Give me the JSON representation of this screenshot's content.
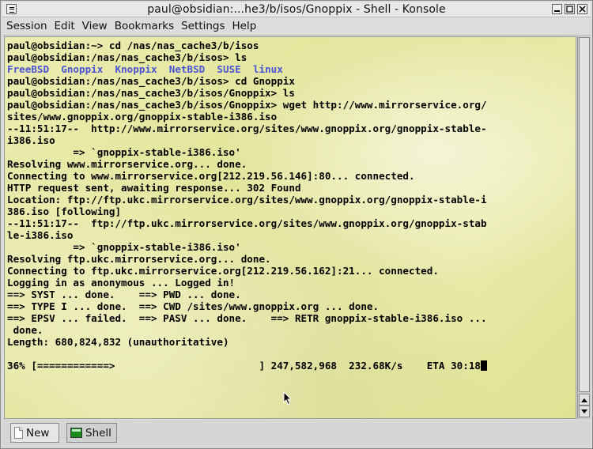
{
  "window": {
    "title": "paul@obsidian:...he3/b/isos/Gnoppix - Shell - Konsole"
  },
  "menubar": {
    "items": [
      "Session",
      "Edit",
      "View",
      "Bookmarks",
      "Settings",
      "Help"
    ]
  },
  "terminal": {
    "lines": [
      "paul@obsidian:~> cd /nas/nas_cache3/b/isos",
      "paul@obsidian:/nas/nas_cache3/b/isos> ls",
      "__LS__",
      "paul@obsidian:/nas/nas_cache3/b/isos> cd Gnoppix",
      "paul@obsidian:/nas/nas_cache3/b/isos/Gnoppix> ls",
      "paul@obsidian:/nas/nas_cache3/b/isos/Gnoppix> wget http://www.mirrorservice.org/",
      "sites/www.gnoppix.org/gnoppix-stable-i386.iso",
      "--11:51:17--  http://www.mirrorservice.org/sites/www.gnoppix.org/gnoppix-stable-",
      "i386.iso",
      "           => `gnoppix-stable-i386.iso'",
      "Resolving www.mirrorservice.org... done.",
      "Connecting to www.mirrorservice.org[212.219.56.146]:80... connected.",
      "HTTP request sent, awaiting response... 302 Found",
      "Location: ftp://ftp.ukc.mirrorservice.org/sites/www.gnoppix.org/gnoppix-stable-i",
      "386.iso [following]",
      "--11:51:17--  ftp://ftp.ukc.mirrorservice.org/sites/www.gnoppix.org/gnoppix-stab",
      "le-i386.iso",
      "           => `gnoppix-stable-i386.iso'",
      "Resolving ftp.ukc.mirrorservice.org... done.",
      "Connecting to ftp.ukc.mirrorservice.org[212.219.56.162]:21... connected.",
      "Logging in as anonymous ... Logged in!",
      "==> SYST ... done.    ==> PWD ... done.",
      "==> TYPE I ... done.  ==> CWD /sites/www.gnoppix.org ... done.",
      "==> EPSV ... failed.  ==> PASV ... done.    ==> RETR gnoppix-stable-i386.iso ...",
      " done.",
      "Length: 680,824,832 (unauthoritative)",
      "",
      "36% [============>                        ] 247,582,968  232.68K/s    ETA 30:18"
    ],
    "ls_entries": [
      "FreeBSD",
      "Gnoppix",
      "Knoppix",
      "NetBSD",
      "SUSE",
      "linux"
    ],
    "ls_color": "#4a54d6"
  },
  "tabbar": {
    "new_label": "New",
    "shell_label": "Shell"
  }
}
